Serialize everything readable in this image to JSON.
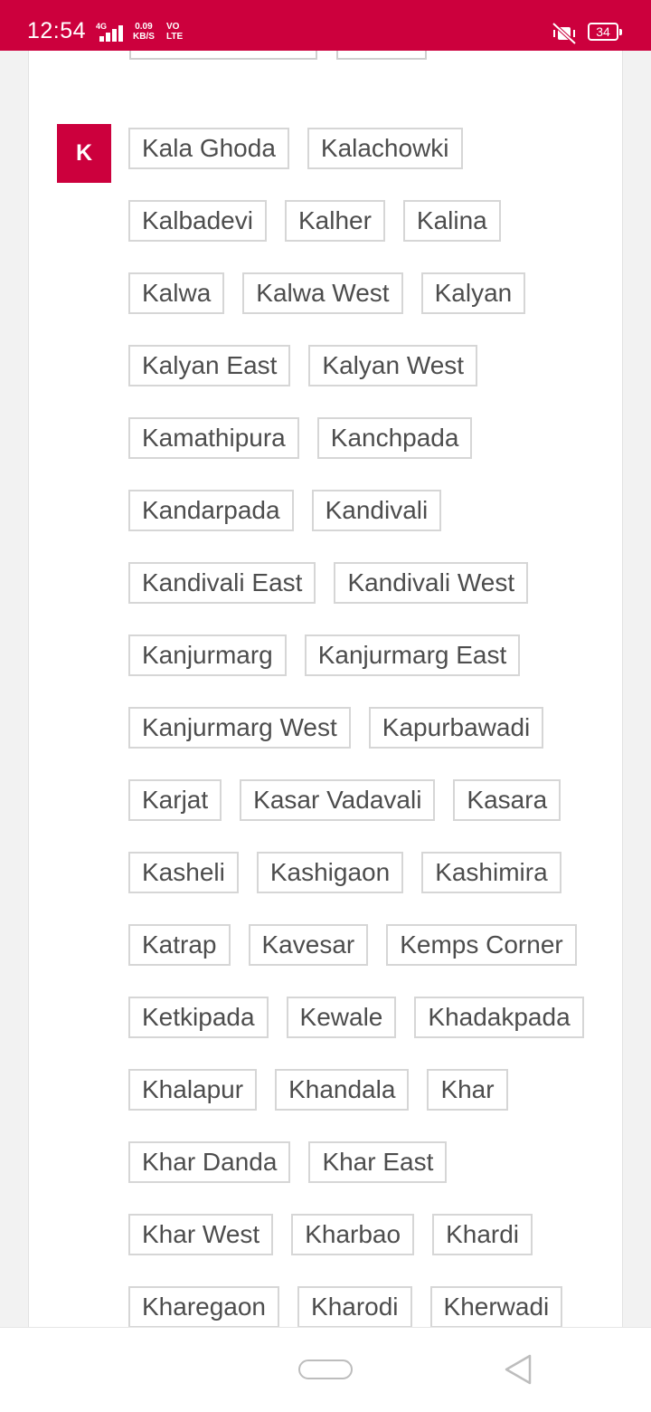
{
  "status_bar": {
    "time": "12:54",
    "network": "4G",
    "speed_value": "0.09",
    "speed_unit": "KB/S",
    "volte_top": "VO",
    "volte_bottom": "LTE",
    "battery": "34",
    "mute_icon": "vibrate-off-icon"
  },
  "section": {
    "letter": "K",
    "rows": [
      [
        "Kala Ghoda",
        "Kalachowki"
      ],
      [
        "Kalbadevi",
        "Kalher",
        "Kalina"
      ],
      [
        "Kalwa",
        "Kalwa West",
        "Kalyan"
      ],
      [
        "Kalyan East",
        "Kalyan West"
      ],
      [
        "Kamathipura",
        "Kanchpada"
      ],
      [
        "Kandarpada",
        "Kandivali"
      ],
      [
        "Kandivali East",
        "Kandivali West"
      ],
      [
        "Kanjurmarg",
        "Kanjurmarg East"
      ],
      [
        "Kanjurmarg West",
        "Kapurbawadi"
      ],
      [
        "Karjat",
        "Kasar Vadavali",
        "Kasara"
      ],
      [
        "Kasheli",
        "Kashigaon",
        "Kashimira"
      ],
      [
        "Katrap",
        "Kavesar",
        "Kemps Corner"
      ],
      [
        "Ketkipada",
        "Kewale",
        "Khadakpada"
      ],
      [
        "Khalapur",
        "Khandala",
        "Khar"
      ],
      [
        "Khar Danda",
        "Khar East"
      ],
      [
        "Khar West",
        "Kharbao",
        "Khardi"
      ],
      [
        "Kharegaon",
        "Kharodi",
        "Kherwadi"
      ]
    ]
  },
  "nav_bar": {
    "home_icon": "home-pill-icon",
    "back_icon": "back-triangle-icon"
  },
  "colors": {
    "accent": "#cc003d",
    "tag_border": "#d6d6d6",
    "tag_text": "#4d4d4d"
  }
}
